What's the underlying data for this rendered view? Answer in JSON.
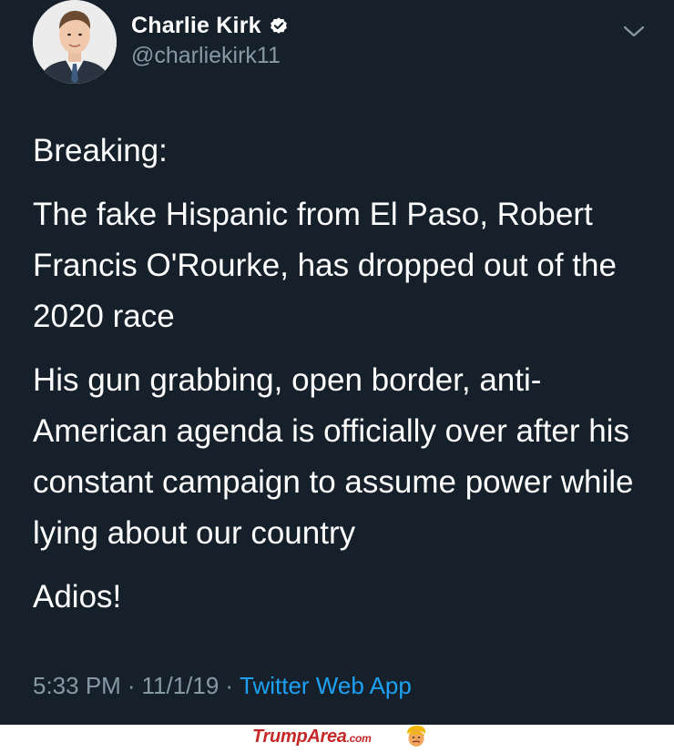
{
  "tweet": {
    "author": {
      "display_name": "Charlie Kirk",
      "handle": "@charliekirk11",
      "verified_icon": "verified-badge-icon",
      "avatar_icon": "profile-photo"
    },
    "menu_icon": "chevron-down-icon",
    "paragraphs": [
      "Breaking:",
      "The fake Hispanic from El Paso, Robert Francis O'Rourke, has dropped out of the 2020 race",
      "His gun grabbing, open border, anti-American agenda is officially over after his constant campaign to assume power while lying about our country",
      "Adios!"
    ],
    "time": "5:33 PM",
    "separator": "·",
    "date": "11/1/19",
    "source": "Twitter Web App"
  },
  "watermark": {
    "site": "TrumpArea",
    "suffix": ".com",
    "icon": "trump-face-icon"
  },
  "colors": {
    "background": "#15202b",
    "text": "#ffffff",
    "secondary_text": "#8899a6",
    "link": "#1da1f2",
    "verified_badge": "#ffffff",
    "watermark_text": "#c62828"
  }
}
